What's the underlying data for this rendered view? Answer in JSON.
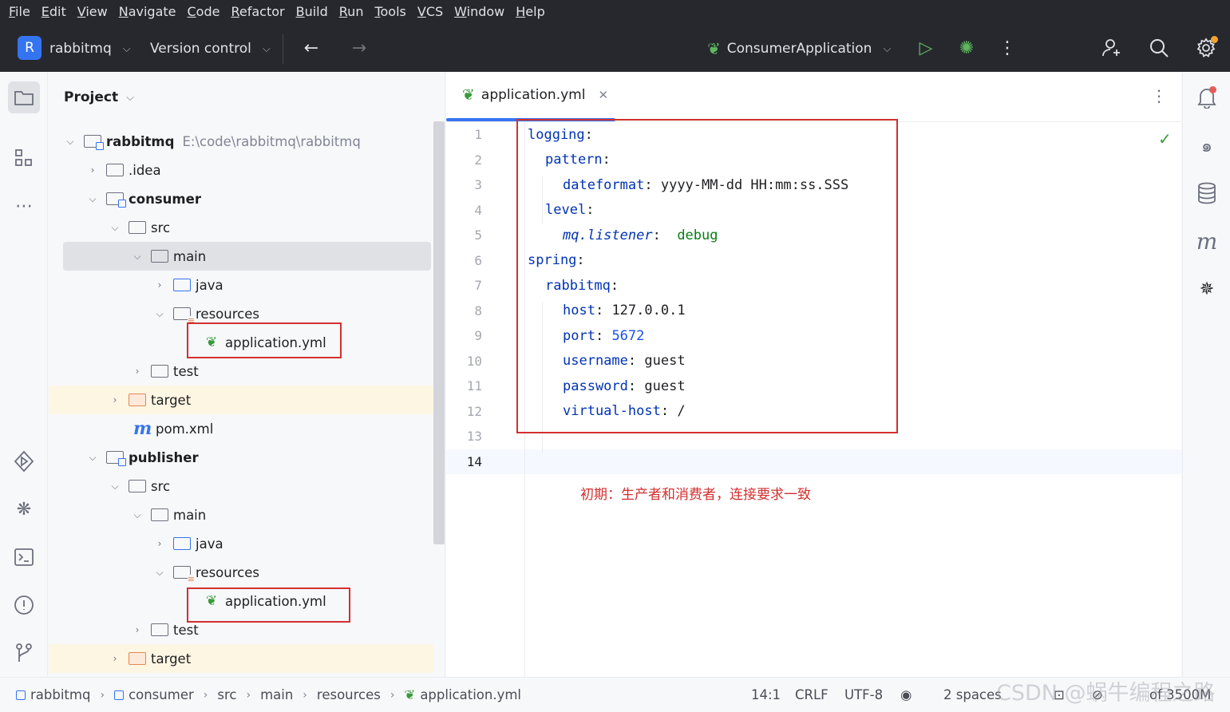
{
  "menu": [
    "File",
    "Edit",
    "View",
    "Navigate",
    "Code",
    "Refactor",
    "Build",
    "Run",
    "Tools",
    "VCS",
    "Window",
    "Help"
  ],
  "toolbar": {
    "project_badge": "R",
    "project_name": "rabbitmq",
    "version_control": "Version control",
    "back_icon": "arrow-left-icon",
    "forward_icon": "arrow-right-icon",
    "run_config": "ConsumerApplication",
    "run_icon": "run-icon",
    "debug_icon": "debug-icon",
    "more_icon": "more-vertical-icon",
    "add_user_icon": "add-user-icon",
    "search_icon": "search-icon",
    "settings_icon": "gear-icon"
  },
  "project_panel": {
    "title": "Project",
    "tree": [
      {
        "label": "rabbitmq",
        "path": "E:\\code\\rabbitmq\\rabbitmq"
      },
      {
        "label": ".idea"
      },
      {
        "label": "consumer"
      },
      {
        "label": "src"
      },
      {
        "label": "main"
      },
      {
        "label": "java"
      },
      {
        "label": "resources"
      },
      {
        "label": "application.yml"
      },
      {
        "label": "test"
      },
      {
        "label": "target"
      },
      {
        "label": "pom.xml"
      },
      {
        "label": "publisher"
      },
      {
        "label": "src"
      },
      {
        "label": "main"
      },
      {
        "label": "java"
      },
      {
        "label": "resources"
      },
      {
        "label": "application.yml"
      },
      {
        "label": "test"
      },
      {
        "label": "target"
      }
    ]
  },
  "editor": {
    "tab_label": "application.yml",
    "line_numbers": [
      "1",
      "2",
      "3",
      "4",
      "5",
      "6",
      "7",
      "8",
      "9",
      "10",
      "11",
      "12",
      "13",
      "14"
    ],
    "code": {
      "l1_key": "logging",
      "l2_key": "pattern",
      "l3_key": "dateformat",
      "l3_val": "yyyy-MM-dd HH:mm:ss.SSS",
      "l4_key": "level",
      "l5_key": "mq.listener",
      "l5_val": "debug",
      "l6_key": "spring",
      "l7_key": "rabbitmq",
      "l8_key": "host",
      "l8_val": "127.0.0.1",
      "l9_key": "port",
      "l9_val": "5672",
      "l10_key": "username",
      "l10_val": "guest",
      "l11_key": "password",
      "l11_val": "guest",
      "l12_key": "virtual-host",
      "l12_val": "/"
    },
    "annotation": "初期：生产者和消费者，连接要求一致"
  },
  "status_bar": {
    "breadcrumbs": [
      "rabbitmq",
      "consumer",
      "src",
      "main",
      "resources",
      "application.yml"
    ],
    "position": "14:1",
    "line_separator": "CRLF",
    "encoding": "UTF-8",
    "indent": "2 spaces",
    "memory": "of 3500M"
  },
  "watermark": "CSDN @蜗牛编程之路",
  "colors": {
    "accent": "#3574f0",
    "annotation_red": "#d32f2f",
    "toolbar_bg": "#27282e"
  }
}
